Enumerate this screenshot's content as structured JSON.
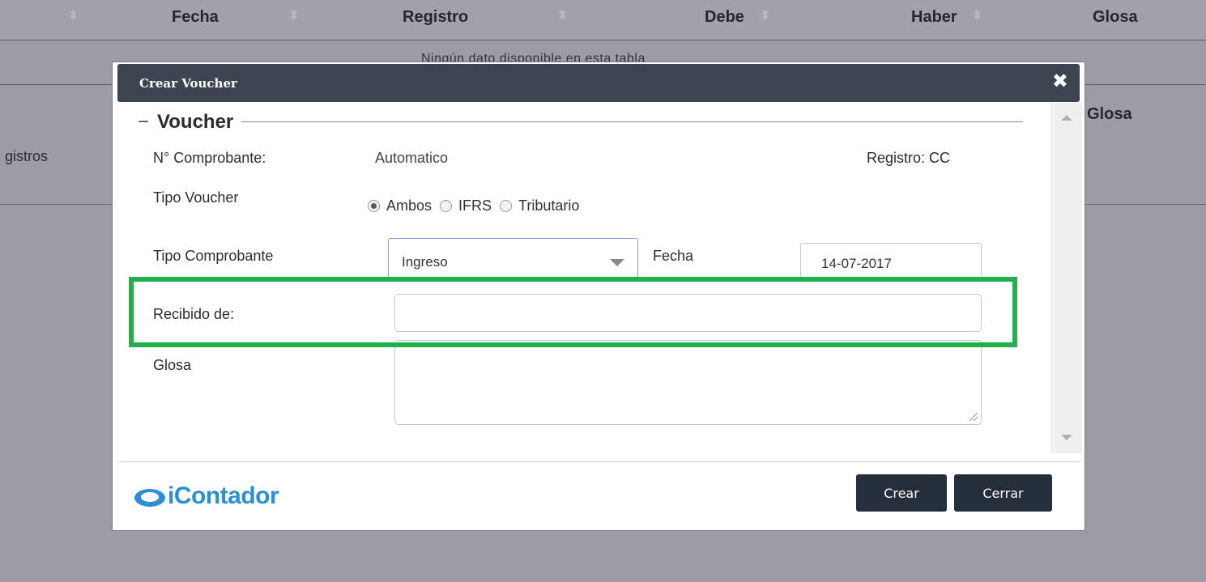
{
  "background": {
    "table_headers": [
      "Fecha",
      "Registro",
      "Debe",
      "Haber",
      "Glosa"
    ],
    "empty_message": "Ningún dato disponible en esta tabla",
    "second_glosa": "Glosa",
    "registros_text": "gistros"
  },
  "modal": {
    "title": "Crear Voucher",
    "close_symbol": "✖",
    "legend": "Voucher",
    "legend_toggle": "−",
    "fields": {
      "comprobante_label": "N° Comprobante:",
      "comprobante_value": "Automatico",
      "registro_label": "Registro: CC",
      "tipo_voucher_label": "Tipo Voucher",
      "tipo_voucher_options": [
        "Ambos",
        "IFRS",
        "Tributario"
      ],
      "tipo_voucher_selected": "Ambos",
      "tipo_comprobante_label": "Tipo Comprobante",
      "tipo_comprobante_value": "Ingreso",
      "fecha_label": "Fecha",
      "fecha_value": "14-07-2017",
      "recibido_label": "Recibido de:",
      "recibido_value": "",
      "glosa_label": "Glosa",
      "glosa_value": ""
    },
    "buttons": {
      "crear": "Crear",
      "cerrar": "Cerrar"
    },
    "logo_text": "iContador"
  },
  "colors": {
    "overlay": "#9d9ca5",
    "modal_header": "#3c4550",
    "button": "#252e3b",
    "highlight": "#23b04a",
    "logo": "#2d8fd3"
  }
}
